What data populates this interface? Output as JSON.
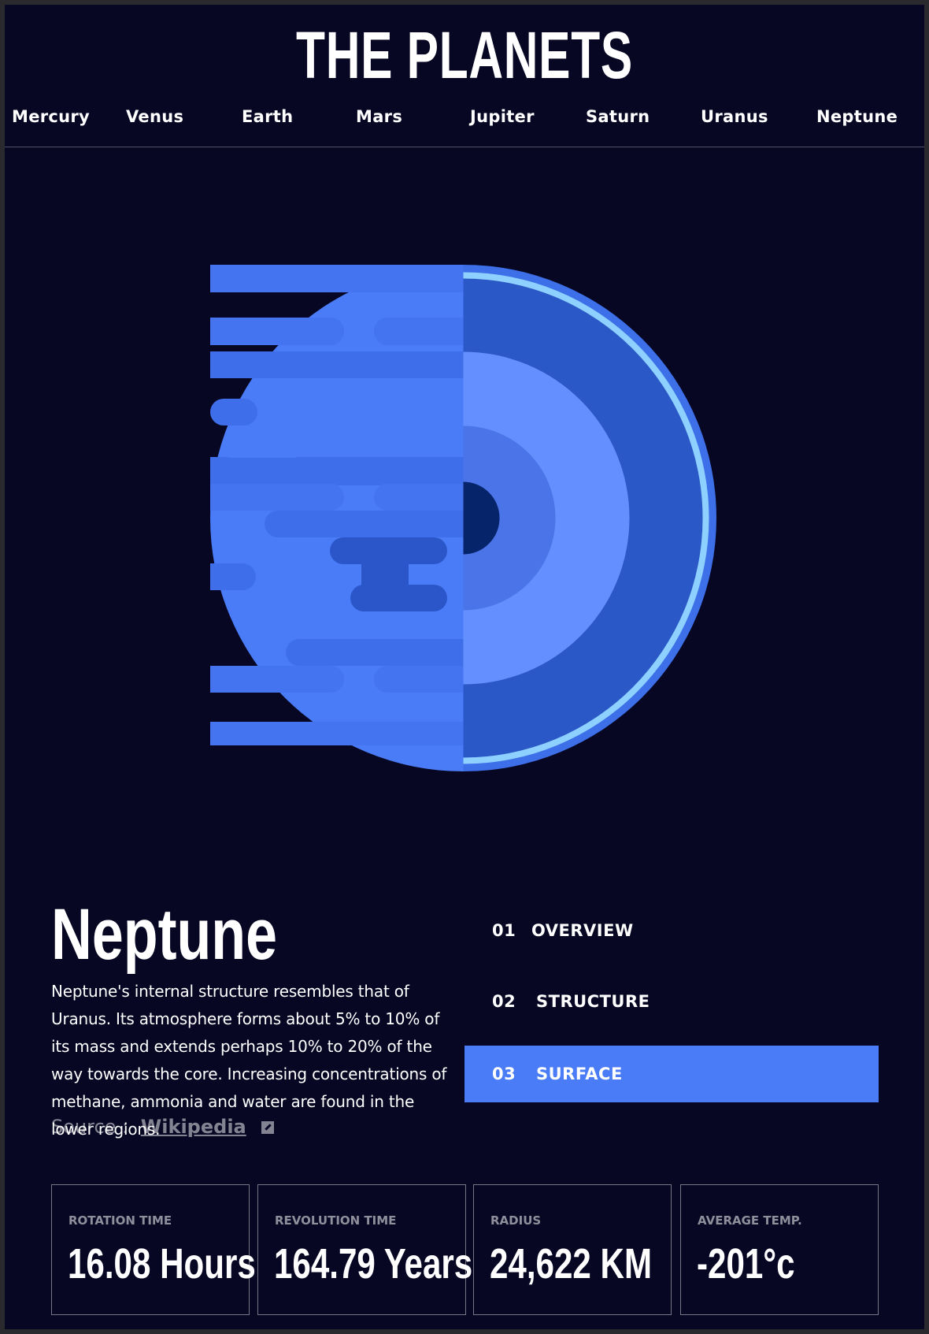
{
  "header": {
    "title": "THE PLANETS",
    "nav": [
      "Mercury",
      "Venus",
      "Earth",
      "Mars",
      "Jupiter",
      "Saturn",
      "Uranus",
      "Neptune"
    ]
  },
  "planet": {
    "name": "Neptune",
    "description": "Neptune's internal structure resembles that of Uranus. Its atmosphere forms about 5% to 10% of its mass and extends perhaps 10% to 20% of the way towards the core. Increasing concentrations of methane, ammonia and water are found in the lower regions.",
    "source_label": "Source :",
    "source_link": "Wikipedia",
    "accent_color": "#4a7cf8"
  },
  "tabs": [
    {
      "num": "01",
      "label": "OVERVIEW",
      "active": false
    },
    {
      "num": "02",
      "label": "STRUCTURE",
      "active": false
    },
    {
      "num": "03",
      "label": "SURFACE",
      "active": true
    }
  ],
  "stats": [
    {
      "label": "ROTATION TIME",
      "value": "16.08 Hours"
    },
    {
      "label": "REVOLUTION TIME",
      "value": "164.79 Years"
    },
    {
      "label": "RADIUS",
      "value": "24,622 KM"
    },
    {
      "label": "AVERAGE TEMP.",
      "value": "-201°c"
    }
  ]
}
